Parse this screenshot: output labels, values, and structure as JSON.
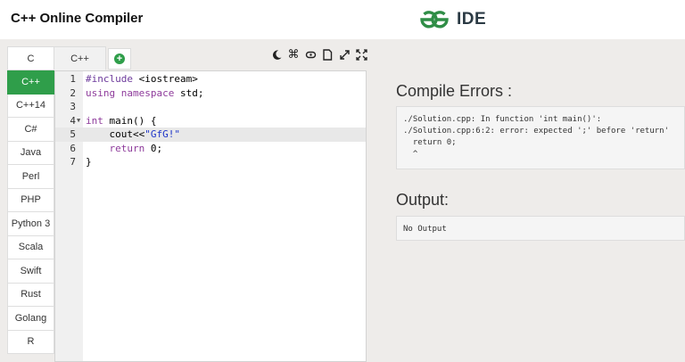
{
  "header": {
    "title": "C++ Online Compiler",
    "logo_text": "IDE",
    "brand_color": "#2f8d46"
  },
  "tabs": {
    "c_label": "C",
    "cpp_label": "C++",
    "add_icon": "plus-circle-icon"
  },
  "toolbar": {
    "icons": [
      "moon-icon",
      "command-icon",
      "share-icon",
      "file-icon",
      "expand-arrows-icon",
      "fullscreen-icon"
    ]
  },
  "languages": {
    "items": [
      "C++",
      "C++14",
      "C#",
      "Java",
      "Perl",
      "PHP",
      "Python 3",
      "Scala",
      "Swift",
      "Rust",
      "Golang",
      "R"
    ],
    "active": "C++",
    "active_color": "#2f9e4a"
  },
  "editor": {
    "line_numbers": [
      "1",
      "2",
      "3",
      "4",
      "5",
      "6",
      "7"
    ],
    "line1": {
      "directive": "#include",
      "header": " <iostream>"
    },
    "line2": {
      "kw_using": "using",
      "kw_namespace": " namespace",
      "rest": " std;"
    },
    "line4": {
      "kw_int": "int",
      "rest": " main() {"
    },
    "line5": {
      "indent": "    cout<<",
      "string": "\"GfG!\""
    },
    "line6": {
      "indent": "    ",
      "kw_return": "return",
      "rest": " 0;"
    },
    "line7": {
      "text": "}"
    },
    "current_line": "5"
  },
  "compile_errors": {
    "heading": "Compile Errors :",
    "lines": [
      "./Solution.cpp: In function 'int main()':",
      "./Solution.cpp:6:2: error: expected ';' before 'return'",
      "  return 0;",
      "  ^"
    ]
  },
  "output": {
    "heading": "Output:",
    "text": "No Output"
  }
}
